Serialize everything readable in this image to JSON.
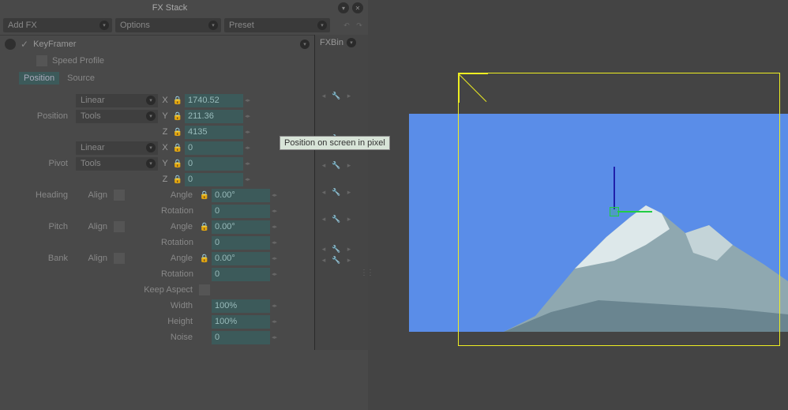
{
  "header": {
    "title": "FX Stack"
  },
  "toolbar": {
    "add_fx": "Add FX",
    "options": "Options",
    "preset": "Preset"
  },
  "fx": {
    "name": "KeyFramer",
    "sub_item": "Speed Profile",
    "sidebar_label": "FXBin"
  },
  "tabs": {
    "position": "Position",
    "source": "Source"
  },
  "groups": {
    "position": {
      "label": "Position",
      "mode": "Linear",
      "tools": "Tools",
      "x_label": "X",
      "x": "1740.52",
      "y_label": "Y",
      "y": "211.36",
      "z_label": "Z",
      "z": "4135"
    },
    "pivot": {
      "label": "Pivot",
      "mode": "Linear",
      "tools": "Tools",
      "x_label": "X",
      "x": "0",
      "y_label": "Y",
      "y": "0",
      "z_label": "Z",
      "z": "0"
    },
    "heading": {
      "label": "Heading",
      "align": "Align",
      "angle_label": "Angle",
      "angle": "0.00°",
      "rotation_label": "Rotation",
      "rotation": "0"
    },
    "pitch": {
      "label": "Pitch",
      "align": "Align",
      "angle_label": "Angle",
      "angle": "0.00°",
      "rotation_label": "Rotation",
      "rotation": "0"
    },
    "bank": {
      "label": "Bank",
      "align": "Align",
      "angle_label": "Angle",
      "angle": "0.00°",
      "rotation_label": "Rotation",
      "rotation": "0"
    },
    "keep_aspect_label": "Keep Aspect",
    "width_label": "Width",
    "width": "100%",
    "height_label": "Height",
    "height": "100%",
    "noise_label": "Noise",
    "noise": "0"
  },
  "tooltip": "Position on screen in pixel"
}
